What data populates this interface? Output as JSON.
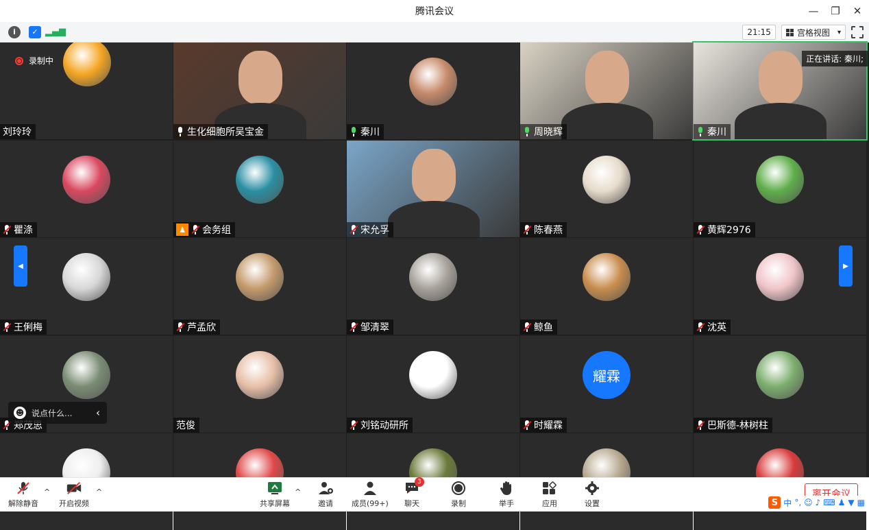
{
  "window": {
    "title": "腾讯会议",
    "controls": [
      "minimize",
      "restore",
      "close"
    ]
  },
  "toolbar": {
    "icons": [
      {
        "name": "info-icon",
        "color": "#555555",
        "glyph": "i"
      },
      {
        "name": "shield-icon",
        "color": "#1677ff",
        "glyph": "✓"
      },
      {
        "name": "signal-icon",
        "color": "#27ae60",
        "glyph": "▮"
      }
    ],
    "time": "21:15",
    "view_label": "宫格视图",
    "view_caret": "▾"
  },
  "recording_label": "录制中",
  "speaking_label": "正在讲话: 秦川;",
  "tiles": [
    {
      "name": "刘玲玲",
      "mic": "none",
      "type": "avatar",
      "bg": "#f6c615",
      "avatar_color": "#f5a623"
    },
    {
      "name": "生化细胞所吴宝金",
      "mic": "on-white",
      "type": "video",
      "bg": "#5a3a2c"
    },
    {
      "name": "秦川",
      "mic": "on",
      "type": "avatar",
      "bg": "#2b2b2b",
      "avatar_color": "#c78a6a"
    },
    {
      "name": "周晓辉",
      "mic": "on",
      "type": "video",
      "bg": "#d9d2c4"
    },
    {
      "name": "秦川",
      "mic": "on",
      "type": "video",
      "bg": "#e8e4dd"
    },
    {
      "name": "瞿涤",
      "mic": "muted",
      "type": "avatar",
      "avatar_color": "#d9485f"
    },
    {
      "name": "会务组",
      "mic": "muted",
      "type": "avatar",
      "avatar_color": "#2a8fa3",
      "cam": true
    },
    {
      "name": "宋允孚",
      "mic": "muted",
      "type": "video",
      "bg": "#7aa6c9"
    },
    {
      "name": "陈春燕",
      "mic": "muted",
      "type": "avatar",
      "avatar_color": "#e8dccb"
    },
    {
      "name": "黄辉2976",
      "mic": "muted",
      "type": "avatar",
      "avatar_color": "#5fae4a"
    },
    {
      "name": "王俐梅",
      "mic": "muted",
      "type": "avatar",
      "avatar_color": "#d8d8d8"
    },
    {
      "name": "芦孟欣",
      "mic": "muted",
      "type": "avatar",
      "avatar_color": "#c49a6c"
    },
    {
      "name": "邹清翠",
      "mic": "muted",
      "type": "avatar",
      "avatar_color": "#a8a29a"
    },
    {
      "name": "鲸鱼",
      "mic": "muted",
      "type": "avatar",
      "avatar_color": "#c98d4d"
    },
    {
      "name": "沈英",
      "mic": "muted",
      "type": "avatar",
      "avatar_color": "#f0c5c8"
    },
    {
      "name": "郑茂思",
      "mic": "muted",
      "type": "avatar",
      "avatar_color": "#7a8c74"
    },
    {
      "name": "范俊",
      "mic": "none",
      "type": "avatar",
      "avatar_color": "#e7bfa8"
    },
    {
      "name": "刘铭动研所",
      "mic": "muted",
      "type": "avatar",
      "avatar_color": "#ffffff"
    },
    {
      "name": "时耀霖",
      "mic": "muted",
      "type": "avatar-text",
      "avatar_text": "耀霖",
      "avatar_color": "#1677ff"
    },
    {
      "name": "巴斯德-林树柱",
      "mic": "muted",
      "type": "avatar",
      "avatar_color": "#7cae6e"
    },
    {
      "name": "",
      "mic": "none",
      "type": "avatar",
      "avatar_color": "#eeeeee"
    },
    {
      "name": "",
      "mic": "none",
      "type": "avatar",
      "avatar_color": "#e04848"
    },
    {
      "name": "",
      "mic": "none",
      "type": "avatar",
      "avatar_color": "#6b7a3a"
    },
    {
      "name": "",
      "mic": "none",
      "type": "avatar",
      "avatar_color": "#b7a990"
    },
    {
      "name": "",
      "mic": "none",
      "type": "avatar",
      "avatar_color": "#d83a3a"
    }
  ],
  "chat_placeholder": "说点什么...",
  "chat_collapse": "‹",
  "nav": {
    "prev": "◀",
    "next": "▶"
  },
  "bottom": {
    "unmute": "解除静音",
    "video": "开启视频",
    "share": "共享屏幕",
    "invite": "邀请",
    "members": "成员(99+)",
    "chat": "聊天",
    "chat_badge": "3",
    "record": "录制",
    "raise_hand": "举手",
    "apps": "应用",
    "settings": "设置",
    "leave": "离开会议",
    "caret": "^"
  },
  "ime": {
    "logo": "S",
    "lang": "中"
  },
  "colors": {
    "accent": "#1677ff",
    "danger": "#e6302e",
    "tile_bg": "#2b2b2b",
    "grid_bg": "#1f1f1f"
  }
}
